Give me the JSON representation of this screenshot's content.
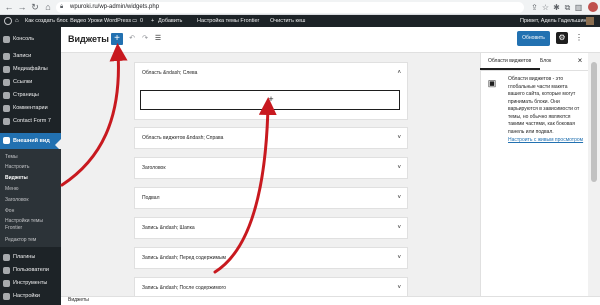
{
  "browser": {
    "url": "wpuroki.ru/wp-admin/widgets.php"
  },
  "admin_bar": {
    "site_name": "Как создать блог. Видео Уроки WordPress",
    "comments": "0",
    "new": "Добавить",
    "theme_settings": "Настройка темы Frontier",
    "clear_cache": "Очистить кеш",
    "greeting": "Привет, Адель Гадельшин"
  },
  "sidebar": {
    "items": [
      {
        "label": "Консоль"
      },
      {
        "label": "Записи"
      },
      {
        "label": "Медиафайлы"
      },
      {
        "label": "Ссылки"
      },
      {
        "label": "Страницы"
      },
      {
        "label": "Комментарии"
      },
      {
        "label": "Contact Form 7"
      },
      {
        "label": "Внешний вид"
      }
    ],
    "submenu": [
      "Темы",
      "Настроить",
      "Виджеты",
      "Меню",
      "Заголовок",
      "Фон",
      "Настройки темы Frontier",
      "Редактор тем"
    ],
    "items_bottom": [
      {
        "label": "Плагины"
      },
      {
        "label": "Пользователи"
      },
      {
        "label": "Инструменты"
      },
      {
        "label": "Настройки"
      }
    ]
  },
  "editor": {
    "title": "Виджеты",
    "publish_label": "Обновить"
  },
  "widget_areas": [
    "Область &ndash; Слева",
    "Область виджетов &ndash; Справа",
    "Заголовок",
    "Подвал",
    "Запись &ndash; Шапка",
    "Запись &ndash; Перед содержимым",
    "Запись &ndash; После содержимого"
  ],
  "footer": {
    "label": "Виджеты"
  },
  "right_panel": {
    "tab_areas": "Области виджетов",
    "tab_block": "Блок",
    "description": "Области виджетов - это глобальные части макета вашего сайта, которые могут принимать блоки. Они варьируются в зависимости от темы, но обычно являются такими частями, как боковая панель или подвал.",
    "link": "Настроить с живым просмотром"
  },
  "colors": {
    "accent": "#2271b1",
    "admin_dark": "#1d2327",
    "annotation_arrow": "#c8191f"
  }
}
